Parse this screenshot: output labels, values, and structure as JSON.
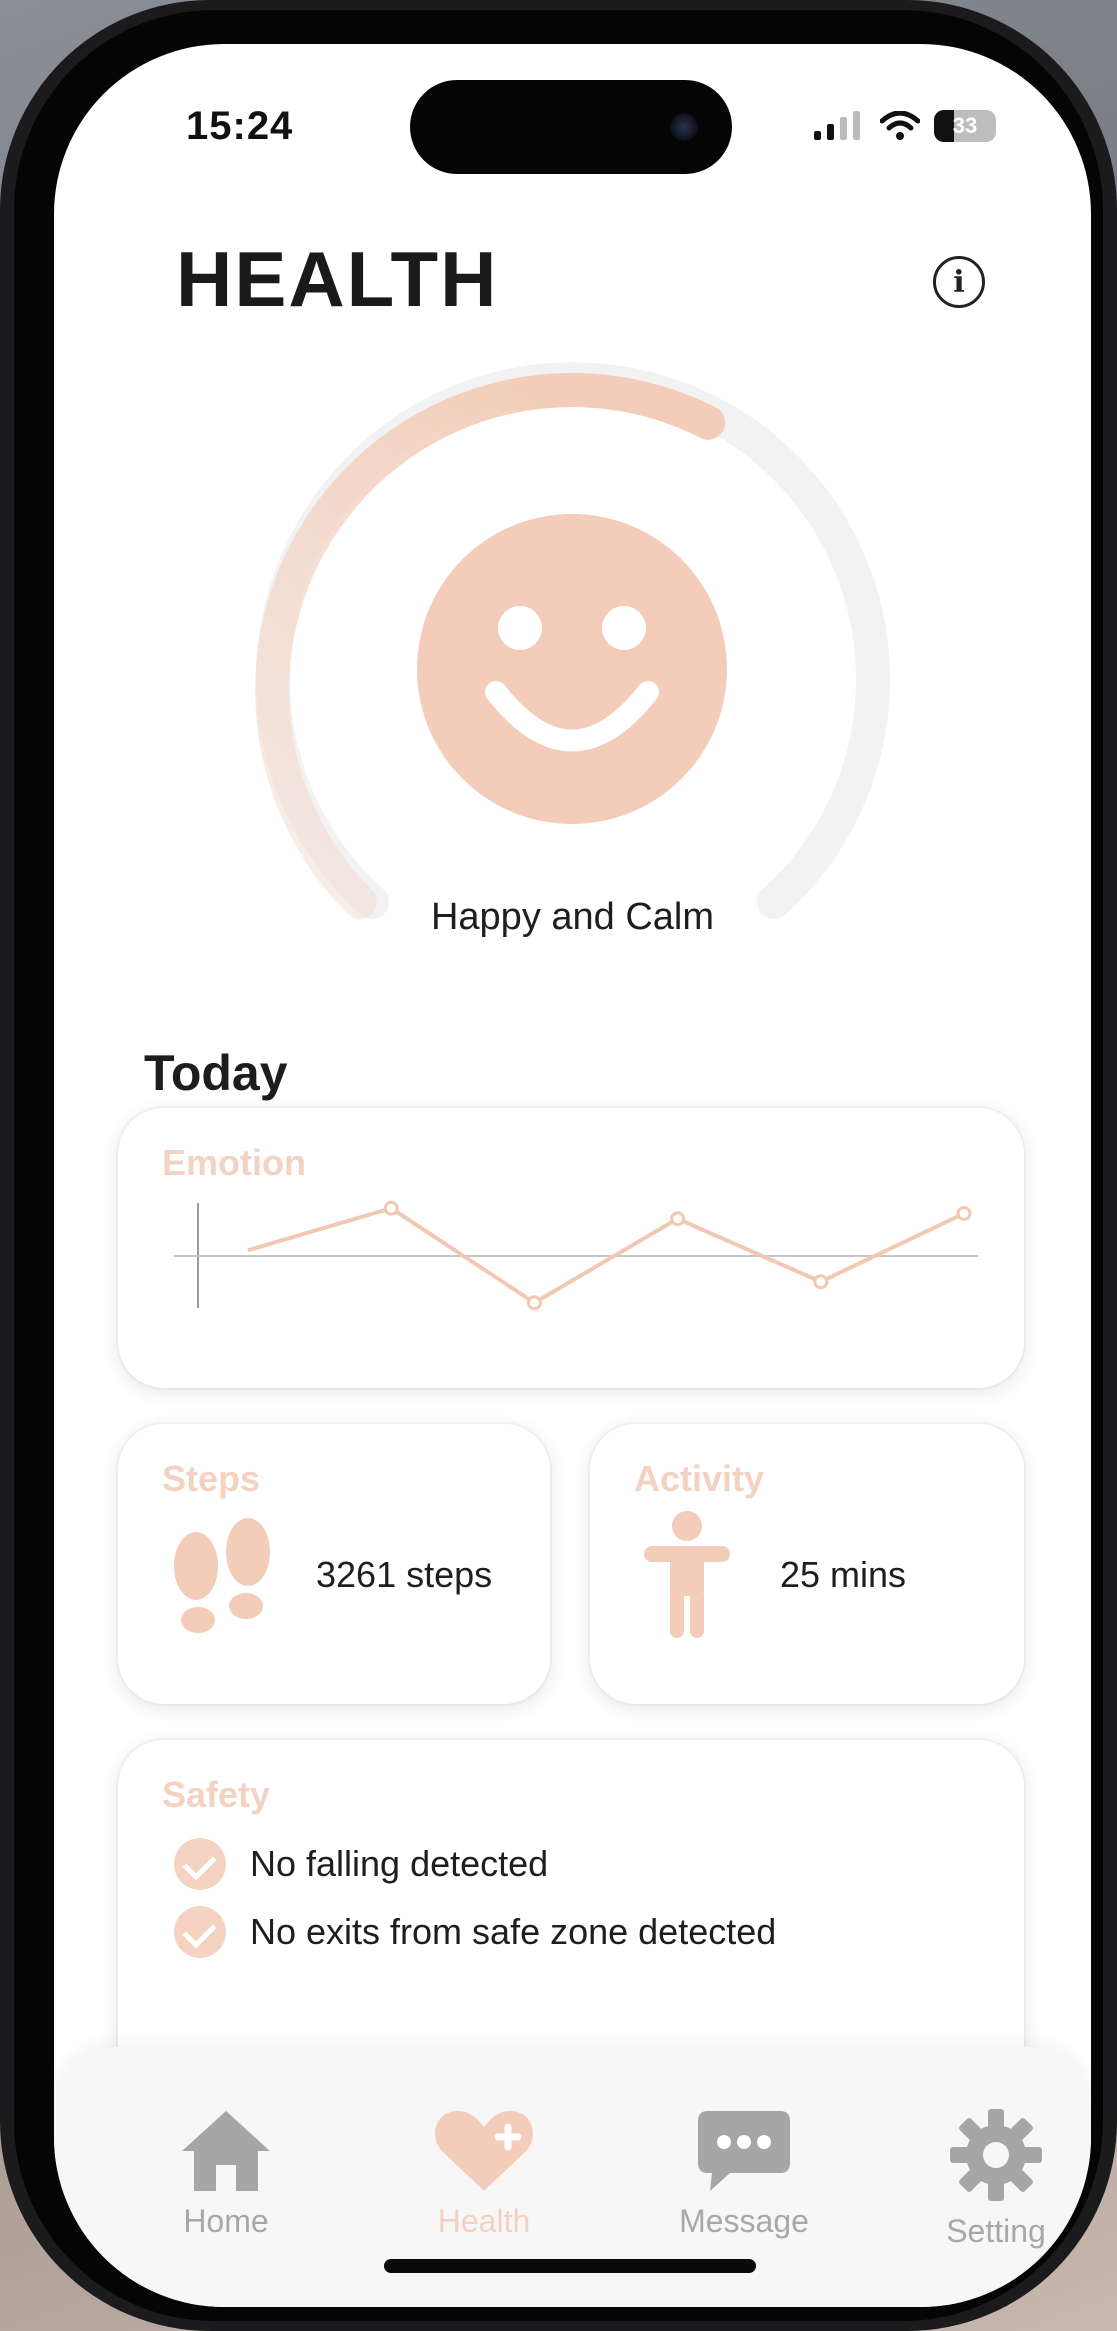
{
  "status_bar": {
    "time": "15:24",
    "battery": "33"
  },
  "header": {
    "title": "HEALTH",
    "info_icon": "info-icon"
  },
  "mood": {
    "label": "Happy and Calm",
    "level": 0.6,
    "accent_color": "#f3cdb9"
  },
  "today": {
    "title": "Today",
    "emotion": {
      "title": "Emotion",
      "trend": [
        0.55,
        0.95,
        0.05,
        0.85,
        0.25,
        0.9
      ]
    },
    "steps": {
      "title": "Steps",
      "value": "3261 steps"
    },
    "activity": {
      "title": "Activity",
      "value": "25 mins"
    },
    "safety": {
      "title": "Safety",
      "items": [
        "No falling detected",
        "No exits from safe zone detected"
      ]
    }
  },
  "tabbar": {
    "items": [
      {
        "label": "Home",
        "icon": "home-icon"
      },
      {
        "label": "Health",
        "icon": "heart-plus-icon",
        "active": true
      },
      {
        "label": "Message",
        "icon": "chat-bubble-icon"
      },
      {
        "label": "Setting",
        "icon": "gear-icon"
      }
    ]
  }
}
